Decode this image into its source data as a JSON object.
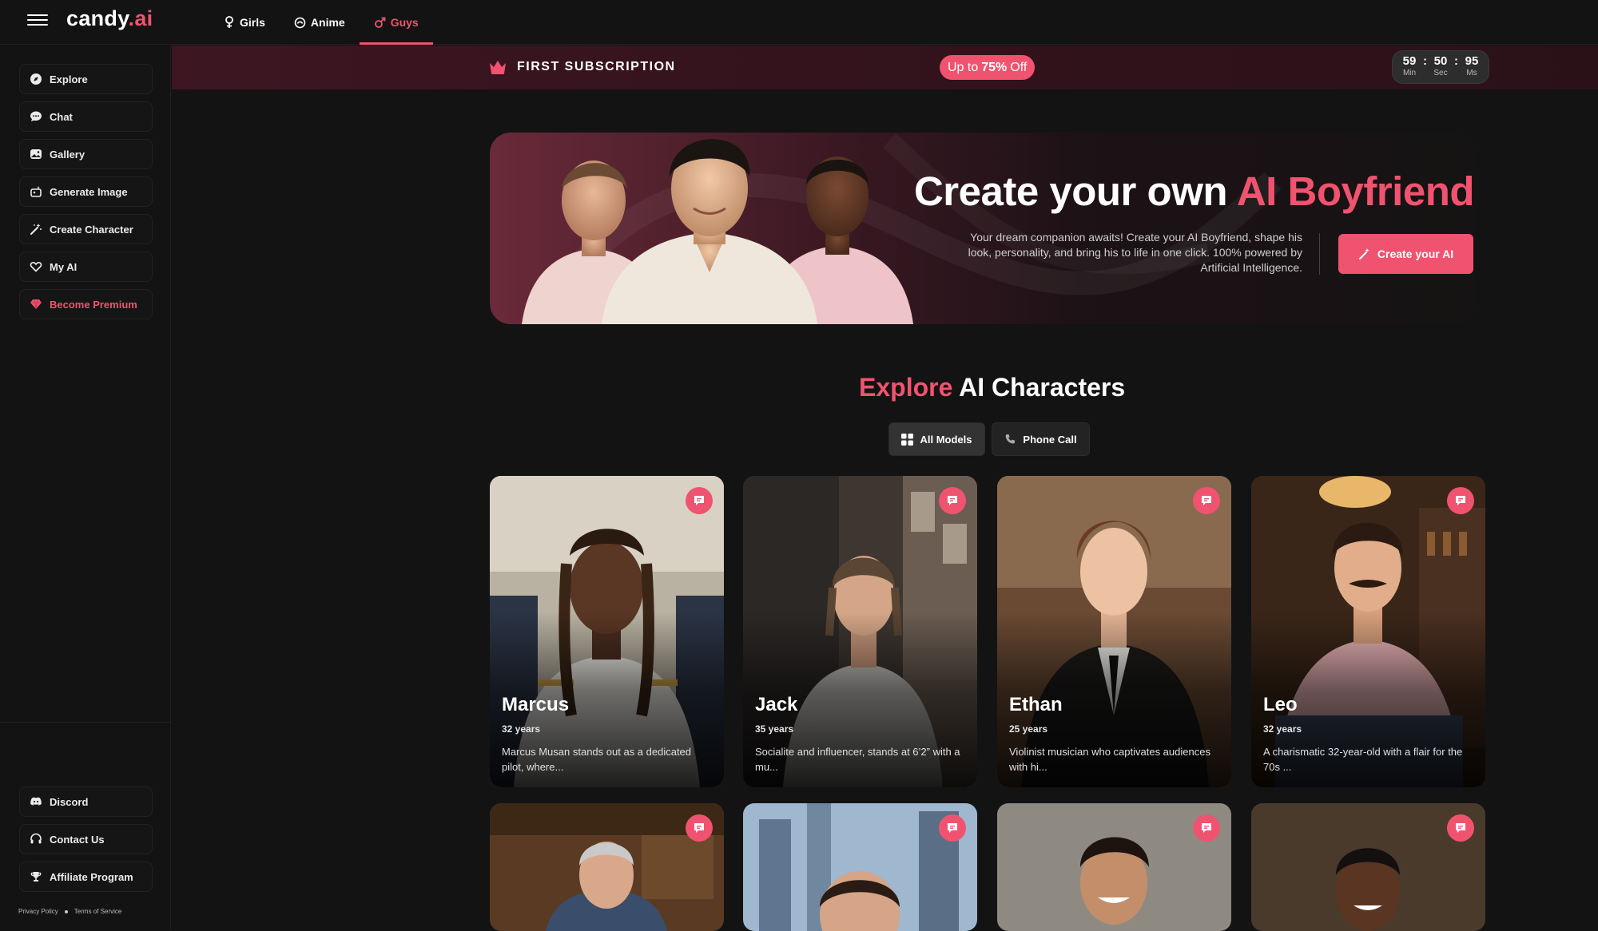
{
  "app": {
    "brand": "candy",
    "tld": ".ai"
  },
  "topnav": [
    {
      "label": "Girls",
      "icon": "female-icon",
      "active": false
    },
    {
      "label": "Anime",
      "icon": "anime-icon",
      "active": false
    },
    {
      "label": "Guys",
      "icon": "male-icon",
      "active": true
    }
  ],
  "sidebar": {
    "items": [
      {
        "label": "Explore",
        "icon": "compass-icon"
      },
      {
        "label": "Chat",
        "icon": "chat-icon"
      },
      {
        "label": "Gallery",
        "icon": "gallery-icon"
      },
      {
        "label": "Generate Image",
        "icon": "image-generate-icon"
      },
      {
        "label": "Create Character",
        "icon": "magic-wand-icon"
      },
      {
        "label": "My AI",
        "icon": "heart-hands-icon"
      },
      {
        "label": "Become Premium",
        "icon": "diamond-icon"
      }
    ],
    "bottom": [
      {
        "label": "Discord",
        "icon": "discord-icon"
      },
      {
        "label": "Contact Us",
        "icon": "headset-icon"
      },
      {
        "label": "Affiliate Program",
        "icon": "trophy-icon"
      }
    ],
    "legal": {
      "privacy": "Privacy Policy",
      "terms": "Terms of Service"
    }
  },
  "promo": {
    "title": "FIRST SUBSCRIPTION",
    "pill_prefix": "Up to",
    "pill_value": "75%",
    "pill_suffix": "Off",
    "timer": {
      "min": "59",
      "sec": "50",
      "ms": "95",
      "min_label": "Min",
      "sec_label": "Sec",
      "ms_label": "Ms"
    }
  },
  "hero": {
    "title_prefix": "Create your own",
    "title_highlight": "AI Boyfriend",
    "text": "Your dream companion awaits! Create your AI Boyfriend, shape his look, personality, and bring his to life in one click. 100% powered by Artificial Intelligence.",
    "button": "Create your AI"
  },
  "explore": {
    "title_highlight": "Explore",
    "title_rest": "AI Characters",
    "filters": [
      {
        "label": "All Models",
        "icon": "grid-icon",
        "active": true
      },
      {
        "label": "Phone Call",
        "icon": "phone-icon",
        "active": false
      }
    ]
  },
  "characters": [
    {
      "name": "Marcus",
      "age": "32 years",
      "desc": "Marcus Musan stands out as a dedicated pilot, where..."
    },
    {
      "name": "Jack",
      "age": "35 years",
      "desc": "Socialite and influencer, stands at 6’2” with a mu..."
    },
    {
      "name": "Ethan",
      "age": "25 years",
      "desc": "Violinist musician who captivates audiences with hi..."
    },
    {
      "name": "Leo",
      "age": "32 years",
      "desc": "A charismatic 32-year-old with a flair for the 70s ..."
    }
  ],
  "colors": {
    "accent": "#f0536f",
    "background": "#131313",
    "panel": "#151515"
  }
}
